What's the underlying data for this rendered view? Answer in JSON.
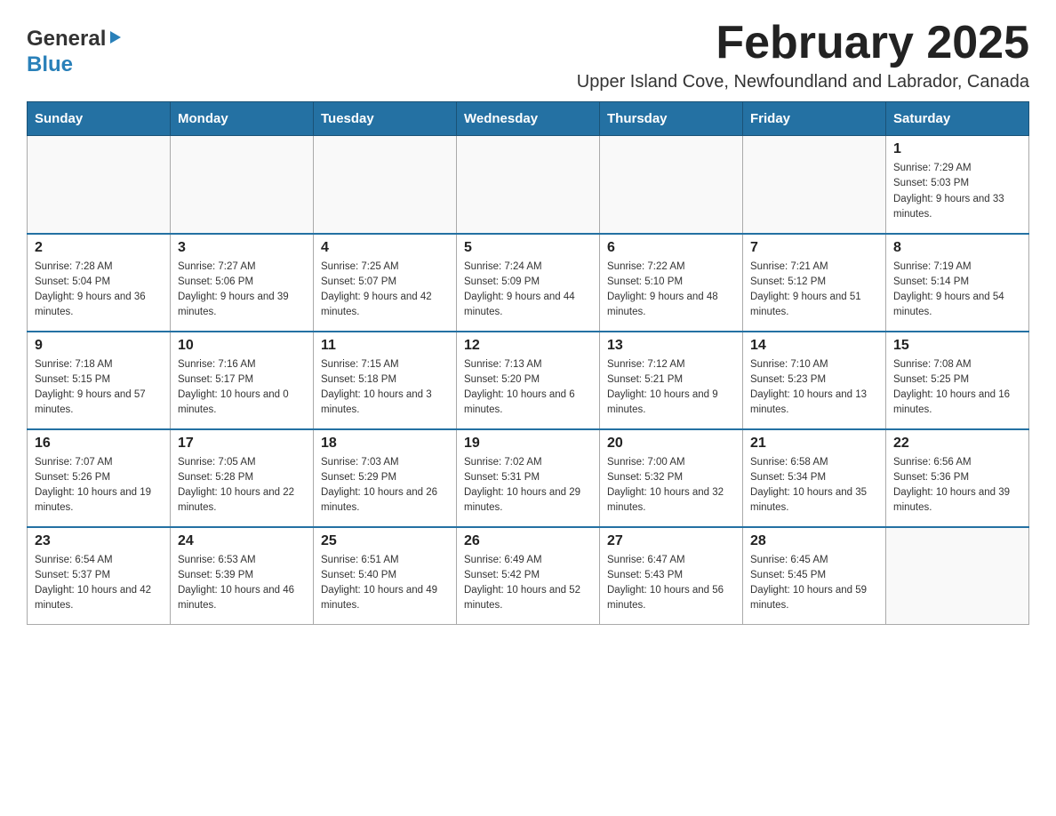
{
  "logo": {
    "general": "General",
    "blue": "Blue"
  },
  "header": {
    "month_year": "February 2025",
    "location": "Upper Island Cove, Newfoundland and Labrador, Canada"
  },
  "days_of_week": [
    "Sunday",
    "Monday",
    "Tuesday",
    "Wednesday",
    "Thursday",
    "Friday",
    "Saturday"
  ],
  "weeks": [
    {
      "days": [
        {
          "number": "",
          "info": ""
        },
        {
          "number": "",
          "info": ""
        },
        {
          "number": "",
          "info": ""
        },
        {
          "number": "",
          "info": ""
        },
        {
          "number": "",
          "info": ""
        },
        {
          "number": "",
          "info": ""
        },
        {
          "number": "1",
          "info": "Sunrise: 7:29 AM\nSunset: 5:03 PM\nDaylight: 9 hours and 33 minutes."
        }
      ]
    },
    {
      "days": [
        {
          "number": "2",
          "info": "Sunrise: 7:28 AM\nSunset: 5:04 PM\nDaylight: 9 hours and 36 minutes."
        },
        {
          "number": "3",
          "info": "Sunrise: 7:27 AM\nSunset: 5:06 PM\nDaylight: 9 hours and 39 minutes."
        },
        {
          "number": "4",
          "info": "Sunrise: 7:25 AM\nSunset: 5:07 PM\nDaylight: 9 hours and 42 minutes."
        },
        {
          "number": "5",
          "info": "Sunrise: 7:24 AM\nSunset: 5:09 PM\nDaylight: 9 hours and 44 minutes."
        },
        {
          "number": "6",
          "info": "Sunrise: 7:22 AM\nSunset: 5:10 PM\nDaylight: 9 hours and 48 minutes."
        },
        {
          "number": "7",
          "info": "Sunrise: 7:21 AM\nSunset: 5:12 PM\nDaylight: 9 hours and 51 minutes."
        },
        {
          "number": "8",
          "info": "Sunrise: 7:19 AM\nSunset: 5:14 PM\nDaylight: 9 hours and 54 minutes."
        }
      ]
    },
    {
      "days": [
        {
          "number": "9",
          "info": "Sunrise: 7:18 AM\nSunset: 5:15 PM\nDaylight: 9 hours and 57 minutes."
        },
        {
          "number": "10",
          "info": "Sunrise: 7:16 AM\nSunset: 5:17 PM\nDaylight: 10 hours and 0 minutes."
        },
        {
          "number": "11",
          "info": "Sunrise: 7:15 AM\nSunset: 5:18 PM\nDaylight: 10 hours and 3 minutes."
        },
        {
          "number": "12",
          "info": "Sunrise: 7:13 AM\nSunset: 5:20 PM\nDaylight: 10 hours and 6 minutes."
        },
        {
          "number": "13",
          "info": "Sunrise: 7:12 AM\nSunset: 5:21 PM\nDaylight: 10 hours and 9 minutes."
        },
        {
          "number": "14",
          "info": "Sunrise: 7:10 AM\nSunset: 5:23 PM\nDaylight: 10 hours and 13 minutes."
        },
        {
          "number": "15",
          "info": "Sunrise: 7:08 AM\nSunset: 5:25 PM\nDaylight: 10 hours and 16 minutes."
        }
      ]
    },
    {
      "days": [
        {
          "number": "16",
          "info": "Sunrise: 7:07 AM\nSunset: 5:26 PM\nDaylight: 10 hours and 19 minutes."
        },
        {
          "number": "17",
          "info": "Sunrise: 7:05 AM\nSunset: 5:28 PM\nDaylight: 10 hours and 22 minutes."
        },
        {
          "number": "18",
          "info": "Sunrise: 7:03 AM\nSunset: 5:29 PM\nDaylight: 10 hours and 26 minutes."
        },
        {
          "number": "19",
          "info": "Sunrise: 7:02 AM\nSunset: 5:31 PM\nDaylight: 10 hours and 29 minutes."
        },
        {
          "number": "20",
          "info": "Sunrise: 7:00 AM\nSunset: 5:32 PM\nDaylight: 10 hours and 32 minutes."
        },
        {
          "number": "21",
          "info": "Sunrise: 6:58 AM\nSunset: 5:34 PM\nDaylight: 10 hours and 35 minutes."
        },
        {
          "number": "22",
          "info": "Sunrise: 6:56 AM\nSunset: 5:36 PM\nDaylight: 10 hours and 39 minutes."
        }
      ]
    },
    {
      "days": [
        {
          "number": "23",
          "info": "Sunrise: 6:54 AM\nSunset: 5:37 PM\nDaylight: 10 hours and 42 minutes."
        },
        {
          "number": "24",
          "info": "Sunrise: 6:53 AM\nSunset: 5:39 PM\nDaylight: 10 hours and 46 minutes."
        },
        {
          "number": "25",
          "info": "Sunrise: 6:51 AM\nSunset: 5:40 PM\nDaylight: 10 hours and 49 minutes."
        },
        {
          "number": "26",
          "info": "Sunrise: 6:49 AM\nSunset: 5:42 PM\nDaylight: 10 hours and 52 minutes."
        },
        {
          "number": "27",
          "info": "Sunrise: 6:47 AM\nSunset: 5:43 PM\nDaylight: 10 hours and 56 minutes."
        },
        {
          "number": "28",
          "info": "Sunrise: 6:45 AM\nSunset: 5:45 PM\nDaylight: 10 hours and 59 minutes."
        },
        {
          "number": "",
          "info": ""
        }
      ]
    }
  ]
}
